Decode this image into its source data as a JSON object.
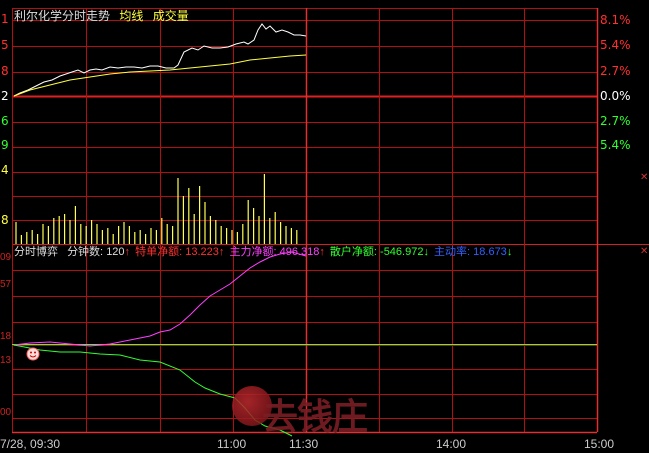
{
  "header": {
    "title": "利尔化学分时走势",
    "avg_label": "均线",
    "vol_label": "成交量"
  },
  "left_prices": [
    "1",
    "5",
    "8",
    "2",
    "6",
    "9",
    "4",
    "8"
  ],
  "right_pcts": [
    "8.1%",
    "5.4%",
    "2.7%",
    "0.0%",
    "2.7%",
    "5.4%"
  ],
  "sub_header": {
    "title": "分时博弈",
    "min_label": "分钟数:",
    "min_value": "120",
    "b1_label": "特单净额:",
    "b1_value": "13.223",
    "b2_label": "主力净额:",
    "b2_value": "496.318",
    "b3_label": "散户净额:",
    "b3_value": "-546.972",
    "b4_label": "主动率:",
    "b4_value": "18.673"
  },
  "sub_left_labels": [
    "09",
    "57",
    "18",
    "13",
    "00"
  ],
  "time_labels": [
    "7/28, 09:30",
    "11:00",
    "11:30",
    "14:00",
    "15:00"
  ],
  "watermark": "去钱庄",
  "colors": {
    "grid": "#b01010",
    "price": "#ffffff",
    "avg": "#ffff40",
    "volume": "#ffff50",
    "magenta": "#ff40ff",
    "green": "#30ff30",
    "up": "#ff3030",
    "down": "#30ff30",
    "blue": "#3060ff"
  },
  "icons": [
    "smiley-icon",
    "close-x-icon",
    "close-x-icon"
  ]
}
